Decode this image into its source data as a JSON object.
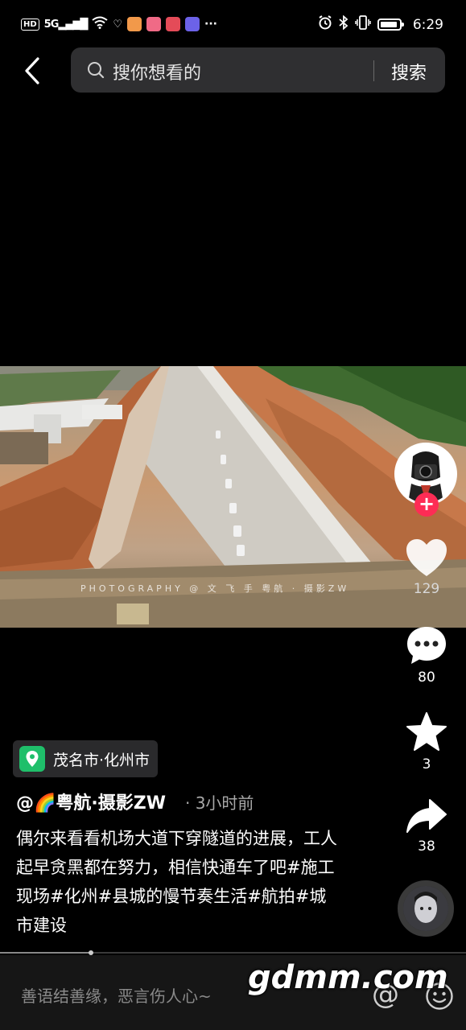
{
  "status_bar": {
    "network_badge": "HD",
    "signal": "5G",
    "time": "6:29",
    "icons": [
      "hd-icon",
      "signal-icon",
      "wifi-icon",
      "app-icons",
      "more-icon",
      "alarm-icon",
      "bluetooth-icon",
      "vibrate-icon",
      "battery-icon"
    ],
    "more": "···"
  },
  "top_bar": {
    "search_placeholder": "搜你想看的",
    "search_button": "搜索"
  },
  "video": {
    "watermark": "PHOTOGRAPHY @ 文 飞 手 粤航 · 摄影ZW"
  },
  "actions": {
    "likes": "129",
    "comments": "80",
    "favorites": "3",
    "shares": "38",
    "follow_symbol": "+"
  },
  "info": {
    "location": "茂名市·化州市",
    "author": "@🌈粤航·摄影ZW",
    "time_ago": "· 3小时前",
    "caption": "偶尔来看看机场大道下穿隧道的进展，工人起早贪黑都在努力，相信快通车了吧#施工现场#化州#县城的慢节奏生活#航拍#城市建设"
  },
  "progress": {
    "fraction": 0.195
  },
  "comment_bar": {
    "placeholder": "善语结善缘，恶言伤人心~",
    "at_symbol": "@"
  },
  "site_watermark": "gdmm.com",
  "colors": {
    "accent": "#fe2c55",
    "location_pin": "#1fbf6a",
    "search_bg": "#2f2f31"
  }
}
